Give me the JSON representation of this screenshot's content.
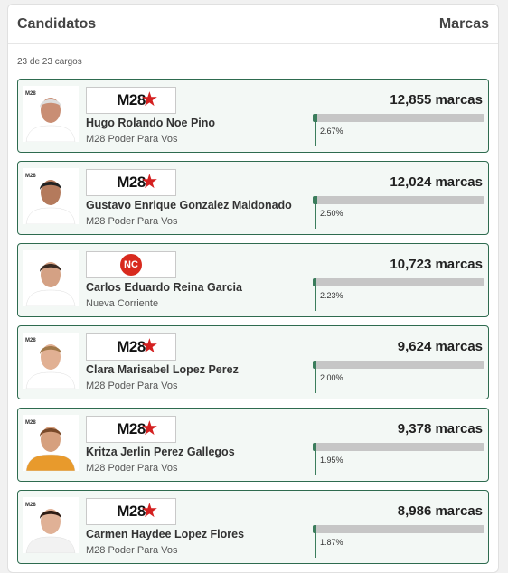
{
  "header": {
    "title": "Candidatos",
    "right_label": "Marcas"
  },
  "summary": "23 de 23 cargos",
  "candidates": [
    {
      "name": "Hugo Rolando Noe Pino",
      "party": "M28 Poder Para Vos",
      "logo": "m28",
      "marks": "12,855 marcas",
      "percent": "2.67%",
      "share": 2.67,
      "photo_tone": "#c98e74",
      "photo_hair": "#ddd",
      "shirt": "#ffffff"
    },
    {
      "name": "Gustavo Enrique Gonzalez Maldonado",
      "party": "M28 Poder Para Vos",
      "logo": "m28",
      "marks": "12,024 marcas",
      "percent": "2.50%",
      "share": 2.5,
      "photo_tone": "#b47a5c",
      "photo_hair": "#222",
      "shirt": "#ffffff"
    },
    {
      "name": "Carlos Eduardo Reina Garcia",
      "party": "Nueva Corriente",
      "logo": "nc",
      "marks": "10,723 marcas",
      "percent": "2.23%",
      "share": 2.23,
      "photo_tone": "#d4a184",
      "photo_hair": "#3a2a22",
      "shirt": "#ffffff"
    },
    {
      "name": "Clara Marisabel Lopez Perez",
      "party": "M28 Poder Para Vos",
      "logo": "m28",
      "marks": "9,624 marcas",
      "percent": "2.00%",
      "share": 2.0,
      "photo_tone": "#e1b093",
      "photo_hair": "#a1794a",
      "shirt": "#ffffff"
    },
    {
      "name": "Kritza Jerlin Perez Gallegos",
      "party": "M28 Poder Para Vos",
      "logo": "m28",
      "marks": "9,378 marcas",
      "percent": "1.95%",
      "share": 1.95,
      "photo_tone": "#d6a07e",
      "photo_hair": "#7a4a2a",
      "shirt": "#e89a2c"
    },
    {
      "name": "Carmen Haydee Lopez Flores",
      "party": "M28 Poder Para Vos",
      "logo": "m28",
      "marks": "8,986 marcas",
      "percent": "1.87%",
      "share": 1.87,
      "photo_tone": "#e0b196",
      "photo_hair": "#2e1c14",
      "shirt": "#f2f2f2"
    }
  ],
  "logos": {
    "m28_text": "M28",
    "m28_mini": "M28",
    "nc_text": "NC"
  },
  "colors": {
    "accent": "#3b7d5c",
    "card_border": "#2e6b4f",
    "card_bg": "#f3f8f5",
    "star": "#d42020"
  }
}
